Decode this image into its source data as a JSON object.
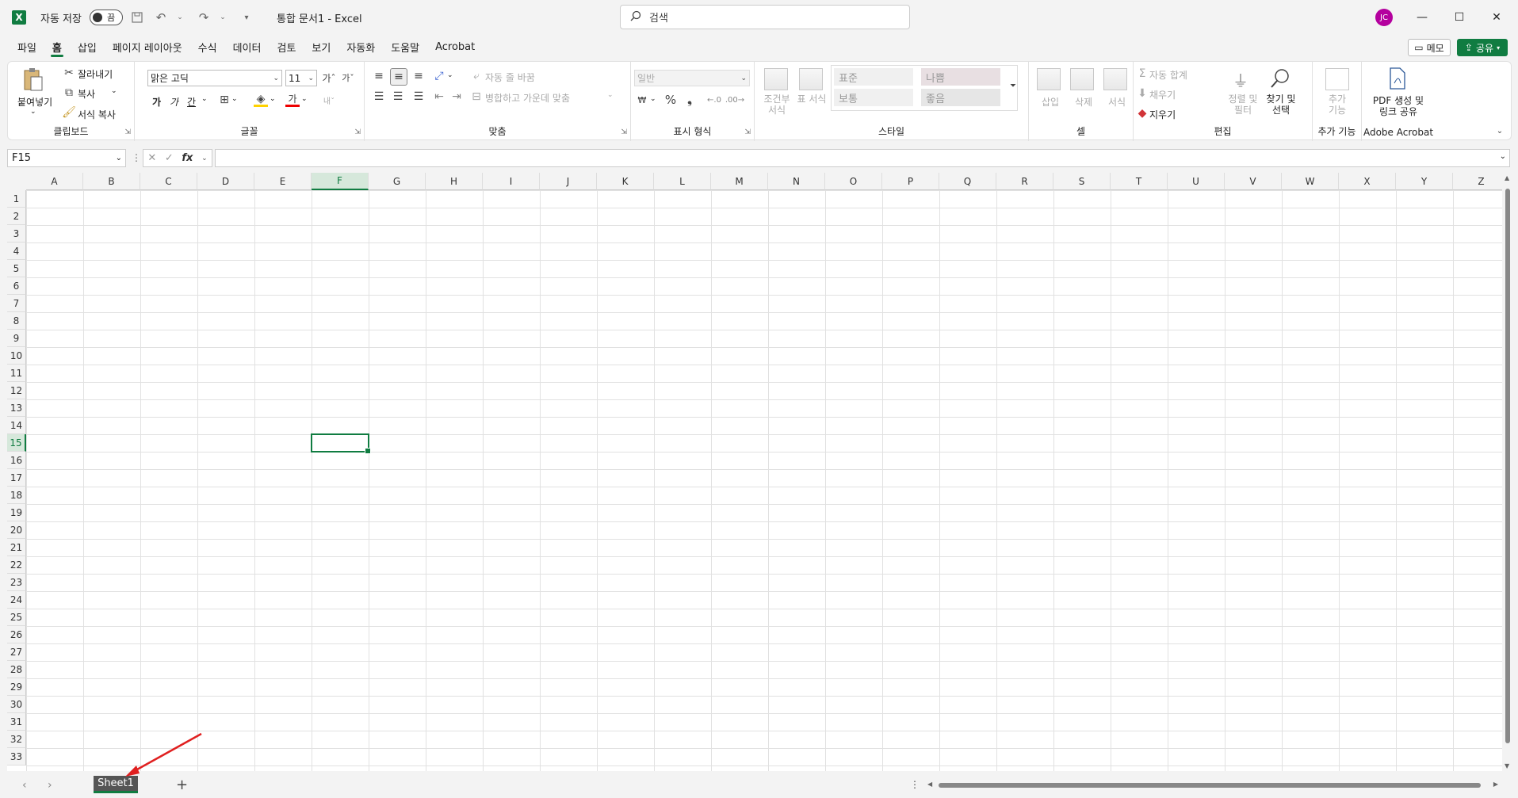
{
  "titlebar": {
    "autosave_label": "자동 저장",
    "toggle_state": "끔",
    "doc_title": "통합 문서1  -  Excel",
    "search_placeholder": "검색",
    "avatar_initials": "JC"
  },
  "menu": {
    "tabs": [
      "파일",
      "홈",
      "삽입",
      "페이지 레이아웃",
      "수식",
      "데이터",
      "검토",
      "보기",
      "자동화",
      "도움말",
      "Acrobat"
    ],
    "active_tab": "홈",
    "memo_label": "메모",
    "share_label": "공유"
  },
  "ribbon": {
    "clipboard": {
      "paste": "붙여넣기",
      "cut": "잘라내기",
      "copy": "복사",
      "format_painter": "서식 복사",
      "label": "클립보드"
    },
    "font": {
      "font_name": "맑은 고딕",
      "font_size": "11",
      "bold": "가",
      "italic": "가",
      "underline": "간",
      "label": "글꼴"
    },
    "alignment": {
      "wrap_text": "자동 줄 바꿈",
      "merge_center": "병합하고 가운데 맞춤",
      "label": "맞춤"
    },
    "number": {
      "format": "일반",
      "label": "표시 형식"
    },
    "styles": {
      "conditional": "조건부 서식",
      "table": "표 서식",
      "normal": "표준",
      "bad": "나쁨",
      "neutral": "보통",
      "good": "좋음",
      "label": "스타일"
    },
    "cells": {
      "insert": "삽입",
      "delete": "삭제",
      "format": "서식",
      "label": "셀"
    },
    "editing": {
      "autosum": "자동 합계",
      "fill": "채우기",
      "clear": "지우기",
      "sort_filter": "정렬 및 필터",
      "find_select": "찾기 및 선택",
      "label": "편집"
    },
    "addins": {
      "button": "추가 기능",
      "label": "추가 기능"
    },
    "acrobat": {
      "button_line1": "PDF 생성 및",
      "button_line2": "링크 공유",
      "label": "Adobe Acrobat"
    }
  },
  "formula_bar": {
    "name_box": "F15",
    "fx": "fx",
    "formula": ""
  },
  "grid": {
    "columns": [
      "A",
      "B",
      "C",
      "D",
      "E",
      "F",
      "G",
      "H",
      "I",
      "J",
      "K",
      "L",
      "M",
      "N",
      "O",
      "P",
      "Q",
      "R",
      "S",
      "T",
      "U",
      "V",
      "W",
      "X",
      "Y",
      "Z"
    ],
    "rows": [
      "1",
      "2",
      "3",
      "4",
      "5",
      "6",
      "7",
      "8",
      "9",
      "10",
      "11",
      "12",
      "13",
      "14",
      "15",
      "16",
      "17",
      "18",
      "19",
      "20",
      "21",
      "22",
      "23",
      "24",
      "25",
      "26",
      "27",
      "28",
      "29",
      "30",
      "31",
      "32",
      "33"
    ],
    "active_column": "F",
    "active_row": "15"
  },
  "sheets": {
    "tabs": [
      "Sheet1"
    ],
    "active": "Sheet1"
  },
  "colors": {
    "accent": "#107c41",
    "annotation": "#e02020"
  }
}
